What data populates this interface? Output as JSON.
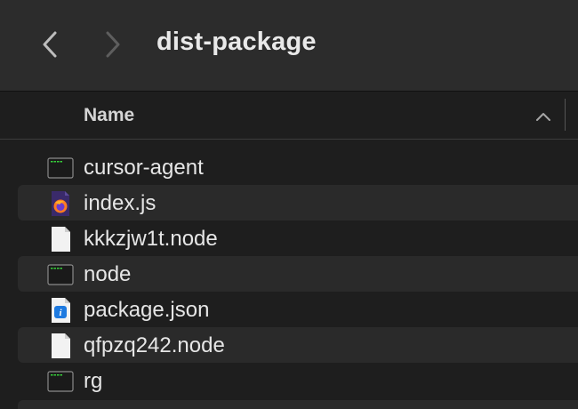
{
  "window": {
    "title": "dist-package"
  },
  "toolbar": {
    "back_icon": "chevron-left-icon",
    "forward_icon": "chevron-right-icon"
  },
  "column_header": {
    "name_label": "Name",
    "sort_icon": "chevron-up-icon",
    "sort_direction": "ascending"
  },
  "files": [
    {
      "name": "cursor-agent",
      "icon": "terminal-executable-icon",
      "alt": false
    },
    {
      "name": "index.js",
      "icon": "firefox-js-file-icon",
      "alt": true
    },
    {
      "name": "kkkzjw1t.node",
      "icon": "blank-document-icon",
      "alt": false
    },
    {
      "name": "node",
      "icon": "terminal-executable-icon",
      "alt": true
    },
    {
      "name": "package.json",
      "icon": "json-info-file-icon",
      "alt": false
    },
    {
      "name": "qfpzq242.node",
      "icon": "blank-document-icon",
      "alt": true
    },
    {
      "name": "rg",
      "icon": "terminal-executable-icon",
      "alt": false
    }
  ],
  "colors": {
    "background": "#1e1e1e",
    "toolbar": "#2c2c2c",
    "alt_row": "#2a2a2a",
    "text": "#e6e6e6"
  }
}
